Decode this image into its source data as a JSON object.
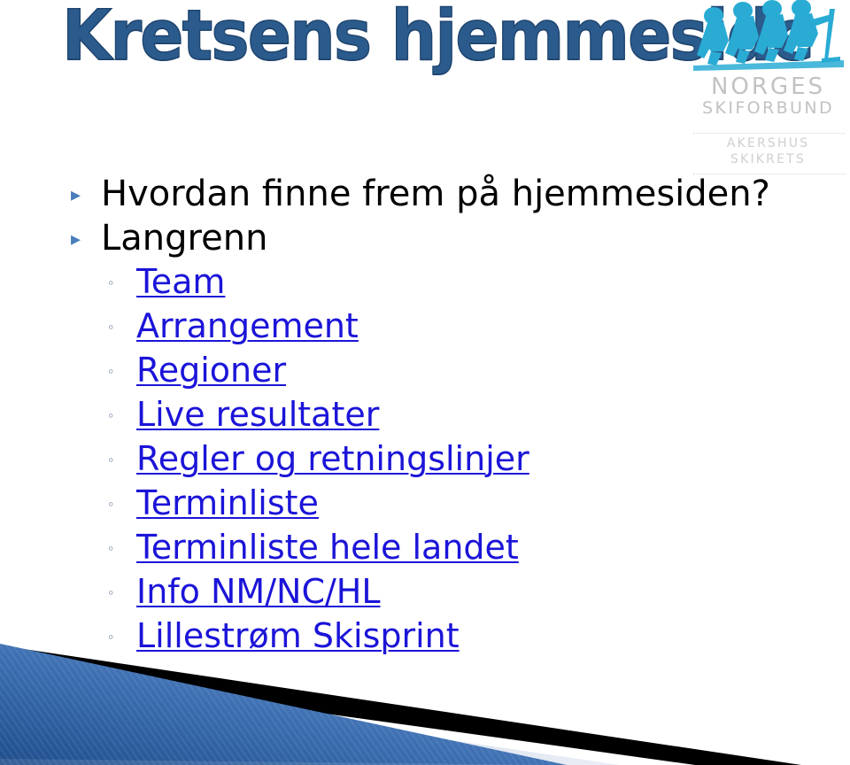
{
  "slide": {
    "title": "Kretsens hjemmeside",
    "colors": {
      "title_blue": "#2B5B8C",
      "link_blue": "#1B14D8",
      "bullet_blue": "#4A7EBB",
      "logo_cyan": "#29ABD4",
      "logo_gray": "#C2C2C2",
      "deco_blue": "#3D6FB0",
      "deco_black": "#000000",
      "deco_light": "#DDE3EF"
    }
  },
  "logo": {
    "skier_icon": "cross-country-skiers-icon",
    "line1": "NORGES",
    "line2": "SKIFORBUND",
    "sub_line1": "AKERSHUS",
    "sub_line2": "SKIKRETS"
  },
  "bullets": [
    {
      "level": 1,
      "marker": "triangle-bullet-icon",
      "text": "Hvordan finne frem på hjemmesiden?",
      "link": false
    },
    {
      "level": 1,
      "marker": "triangle-bullet-icon",
      "text": "Langrenn",
      "link": false
    },
    {
      "level": 2,
      "marker": "circle-bullet-icon",
      "text": "Team",
      "link": true
    },
    {
      "level": 2,
      "marker": "circle-bullet-icon",
      "text": "Arrangement",
      "link": true
    },
    {
      "level": 2,
      "marker": "circle-bullet-icon",
      "text": "Regioner",
      "link": true
    },
    {
      "level": 2,
      "marker": "circle-bullet-icon",
      "text": "Live resultater",
      "link": true
    },
    {
      "level": 2,
      "marker": "circle-bullet-icon",
      "text": "Regler og retningslinjer",
      "link": true
    },
    {
      "level": 2,
      "marker": "circle-bullet-icon",
      "text": "Terminliste",
      "link": true
    },
    {
      "level": 2,
      "marker": "circle-bullet-icon",
      "text": "Terminliste hele landet",
      "link": true
    },
    {
      "level": 2,
      "marker": "circle-bullet-icon",
      "text": "Info NM/NC/HL",
      "link": true
    },
    {
      "level": 2,
      "marker": "circle-bullet-icon",
      "text": "Lillestrøm Skisprint",
      "link": true
    }
  ],
  "markers": {
    "triangle": "▸",
    "circle": "◦"
  }
}
